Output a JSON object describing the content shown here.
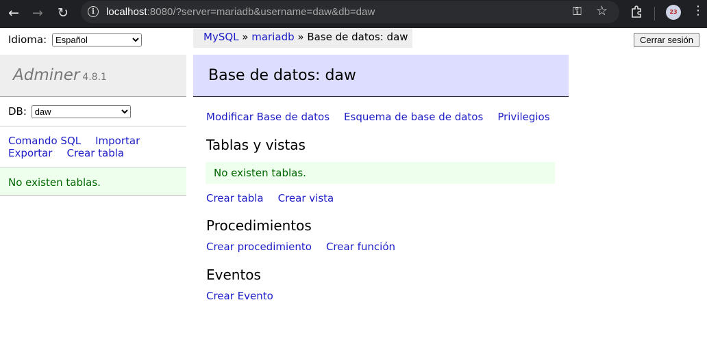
{
  "browser": {
    "url": "localhost:8080/?server=mariadb&username=daw&db=daw",
    "url_host": "localhost",
    "url_rest": ":8080/?server=mariadb&username=daw&db=daw"
  },
  "language": {
    "label": "Idioma:",
    "selected": "Español"
  },
  "breadcrumb": {
    "item1": "MySQL",
    "sep1": " » ",
    "item2": "mariadb",
    "sep2": " » ",
    "current": "Base de datos: daw"
  },
  "logout_label": "Cerrar sesión",
  "app": {
    "name": "Adminer",
    "version": "4.8.1"
  },
  "db_select": {
    "label": "DB:",
    "selected": "daw"
  },
  "sidebar": {
    "links": [
      "Comando SQL",
      "Importar",
      "Exportar",
      "Crear tabla"
    ],
    "message": "No existen tablas."
  },
  "main": {
    "title": "Base de datos: daw",
    "links": [
      "Modificar Base de datos",
      "Esquema de base de datos",
      "Privilegios"
    ],
    "tables_title": "Tablas y vistas",
    "tables_message": "No existen tablas.",
    "tables_links": [
      "Crear tabla",
      "Crear vista"
    ],
    "procedures_title": "Procedimientos",
    "procedures_links": [
      "Crear procedimiento",
      "Crear función"
    ],
    "events_title": "Eventos",
    "events_links": [
      "Crear Evento"
    ]
  }
}
